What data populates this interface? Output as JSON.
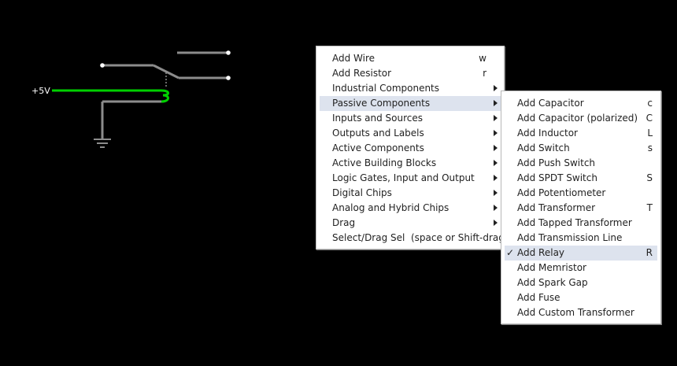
{
  "circuit": {
    "voltage_label": "+5V",
    "colors": {
      "wire_inactive": "#8c8c8c",
      "wire_active": "#00d000",
      "ground": "#8c8c8c",
      "node": "#ffffff",
      "label": "#ffffff"
    }
  },
  "context_menu": {
    "items": [
      {
        "label": "Add Wire",
        "shortcut": "w",
        "has_submenu": false
      },
      {
        "label": "Add Resistor",
        "shortcut": "r",
        "has_submenu": false
      },
      {
        "label": "Industrial Components",
        "shortcut": "",
        "has_submenu": true
      },
      {
        "label": "Passive Components",
        "shortcut": "",
        "has_submenu": true,
        "highlighted": true
      },
      {
        "label": "Inputs and Sources",
        "shortcut": "",
        "has_submenu": true
      },
      {
        "label": "Outputs and Labels",
        "shortcut": "",
        "has_submenu": true
      },
      {
        "label": "Active Components",
        "shortcut": "",
        "has_submenu": true
      },
      {
        "label": "Active Building Blocks",
        "shortcut": "",
        "has_submenu": true
      },
      {
        "label": "Logic Gates, Input and Output",
        "shortcut": "",
        "has_submenu": true
      },
      {
        "label": "Digital Chips",
        "shortcut": "",
        "has_submenu": true
      },
      {
        "label": "Analog and Hybrid Chips",
        "shortcut": "",
        "has_submenu": true
      },
      {
        "label": "Drag",
        "shortcut": "",
        "has_submenu": true
      },
      {
        "label": "Select/Drag Sel  (space or Shift-drag)",
        "shortcut": "",
        "has_submenu": false
      }
    ]
  },
  "passive_submenu": {
    "items": [
      {
        "label": "Add Capacitor",
        "shortcut": "c"
      },
      {
        "label": "Add Capacitor (polarized)",
        "shortcut": "C"
      },
      {
        "label": "Add Inductor",
        "shortcut": "L"
      },
      {
        "label": "Add Switch",
        "shortcut": "s"
      },
      {
        "label": "Add Push Switch",
        "shortcut": ""
      },
      {
        "label": "Add SPDT Switch",
        "shortcut": "S"
      },
      {
        "label": "Add Potentiometer",
        "shortcut": ""
      },
      {
        "label": "Add Transformer",
        "shortcut": "T"
      },
      {
        "label": "Add Tapped Transformer",
        "shortcut": ""
      },
      {
        "label": "Add Transmission Line",
        "shortcut": ""
      },
      {
        "label": "Add Relay",
        "shortcut": "R",
        "checked": true,
        "highlighted": true,
        "check_mark": "✓"
      },
      {
        "label": "Add Memristor",
        "shortcut": ""
      },
      {
        "label": "Add Spark Gap",
        "shortcut": ""
      },
      {
        "label": "Add Fuse",
        "shortcut": ""
      },
      {
        "label": "Add Custom Transformer",
        "shortcut": ""
      }
    ]
  }
}
